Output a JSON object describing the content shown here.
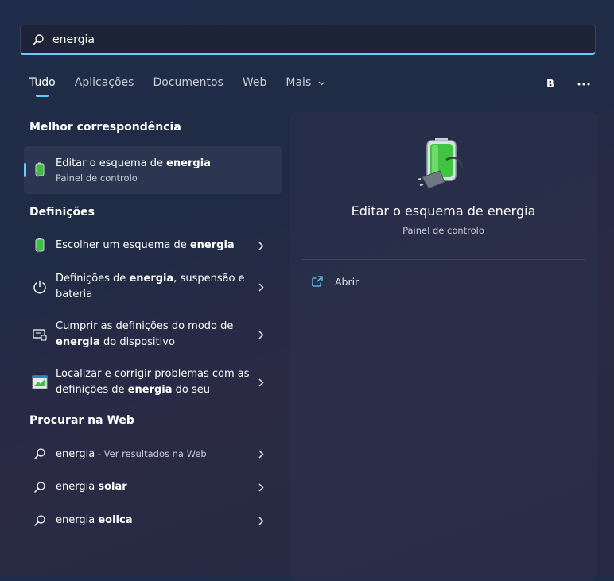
{
  "search": {
    "value": "energia",
    "placeholder": ""
  },
  "tabs": [
    {
      "label": "Tudo",
      "active": true
    },
    {
      "label": "Aplicações"
    },
    {
      "label": "Documentos"
    },
    {
      "label": "Web"
    },
    {
      "label": "Mais"
    }
  ],
  "user": {
    "initial": "B"
  },
  "best_match": {
    "heading": "Melhor correspondência",
    "title_prefix": "Editar o esquema de ",
    "title_bold": "energia",
    "subtitle": "Painel de controlo",
    "icon": "battery-plug-icon"
  },
  "settings": {
    "heading": "Definições",
    "items": [
      {
        "parts": [
          "Escolher um esquema de ",
          "energia"
        ],
        "icon": "battery-plug-icon"
      },
      {
        "parts": [
          "Definições de ",
          "energia",
          ", suspensão e bateria"
        ],
        "icon": "power-icon"
      },
      {
        "parts": [
          "Cumprir as definições do modo de ",
          "energia",
          " do dispositivo"
        ],
        "icon": "device-mode-icon"
      },
      {
        "parts": [
          "Localizar e corrigir problemas com as definições de ",
          "energia",
          " do seu"
        ],
        "icon": "troubleshoot-icon"
      }
    ]
  },
  "web": {
    "heading": "Procurar na Web",
    "items": [
      {
        "term": "energia",
        "suffix": " - Ver resultados na Web"
      },
      {
        "term_prefix": "energia ",
        "term_bold": "solar"
      },
      {
        "term_prefix": "energia ",
        "term_bold": "eolica"
      }
    ]
  },
  "preview": {
    "title": "Editar o esquema de energia",
    "subtitle": "Painel de controlo",
    "action_label": "Abrir"
  },
  "colors": {
    "accent": "#60cdff",
    "background": "#202b45"
  }
}
